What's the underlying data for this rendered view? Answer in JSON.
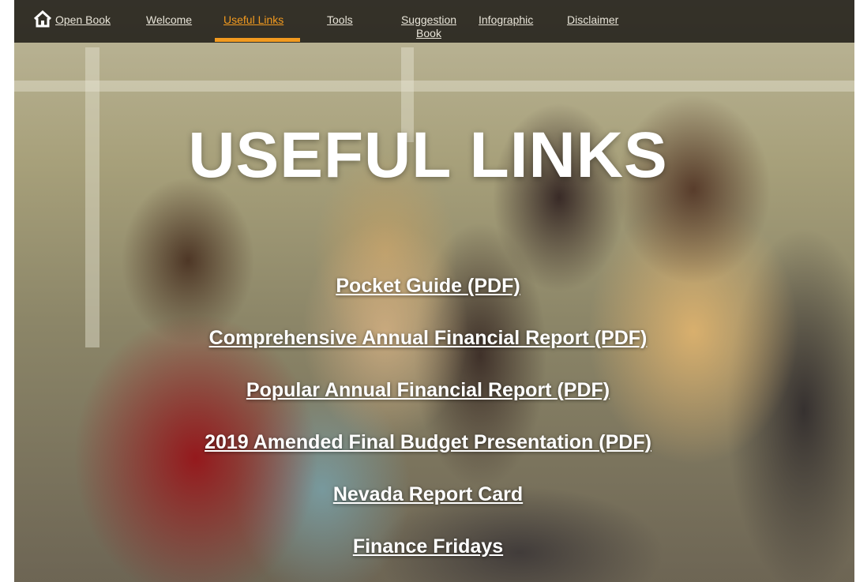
{
  "nav": {
    "home_icon": "home-icon",
    "items": [
      {
        "label": "Open Book"
      },
      {
        "label": "Welcome"
      },
      {
        "label": "Useful Links",
        "active": true
      },
      {
        "label": "Tools"
      },
      {
        "label": "Suggestion Book"
      },
      {
        "label": "Infographic"
      },
      {
        "label": "Disclaimer"
      }
    ],
    "active_color": "#f29a1f"
  },
  "hero": {
    "title": "USEFUL LINKS"
  },
  "links": [
    {
      "label": "Pocket Guide (PDF)"
    },
    {
      "label": "Comprehensive Annual Financial Report (PDF)"
    },
    {
      "label": "Popular Annual Financial Report (PDF)"
    },
    {
      "label": "2019 Amended Final Budget Presentation (PDF)"
    },
    {
      "label": "Nevada Report Card"
    },
    {
      "label": "Finance Fridays"
    }
  ]
}
